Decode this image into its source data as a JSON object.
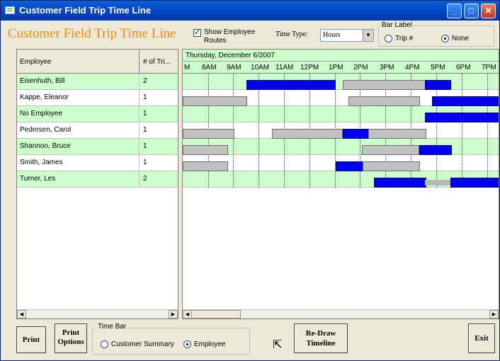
{
  "window": {
    "title": "Customer Field Trip Time Line"
  },
  "form_title": "Customer Field Trip Time Line",
  "show_routes": {
    "label_line1": "Show Employee",
    "label_line2": "Routes",
    "checked": true
  },
  "time_type": {
    "label": "Time Type:",
    "value": "Hours"
  },
  "bar_label": {
    "title": "Bar Label",
    "options": [
      "Trip #",
      "None"
    ],
    "selected": "None"
  },
  "grid": {
    "columns": [
      "Employee",
      "# of Tri..."
    ],
    "rows": [
      {
        "name": "Eisenhuth, Bill",
        "trips": "2"
      },
      {
        "name": "Kappe, Eleanor",
        "trips": "1"
      },
      {
        "name": "No Employee",
        "trips": "1"
      },
      {
        "name": "Pedersen, Carol",
        "trips": "1"
      },
      {
        "name": "Shannon, Bruce",
        "trips": "1"
      },
      {
        "name": "Smith, James",
        "trips": "1"
      },
      {
        "name": "Turner, Les",
        "trips": "2"
      }
    ]
  },
  "timeline": {
    "date": "Thursday, December 6/2007",
    "hours": [
      "M",
      "8AM",
      "9AM",
      "10AM",
      "11AM",
      "12PM",
      "1PM",
      "2PM",
      "3PM",
      "4PM",
      "5PM",
      "6PM",
      "7PM"
    ]
  },
  "time_bar": {
    "title": "Time Bar",
    "options": [
      "Customer Summary",
      "Employee"
    ],
    "selected": "Employee"
  },
  "buttons": {
    "print": "Print",
    "print_options_1": "Print",
    "print_options_2": "Options",
    "redraw_1": "Re-Draw",
    "redraw_2": "Timeline",
    "exit": "Exit"
  },
  "colors": {
    "accent_title": "#f08a12",
    "row_green": "#ccffcc",
    "bar_blue": "#0000f0",
    "bar_grey": "#c0c0c0"
  }
}
